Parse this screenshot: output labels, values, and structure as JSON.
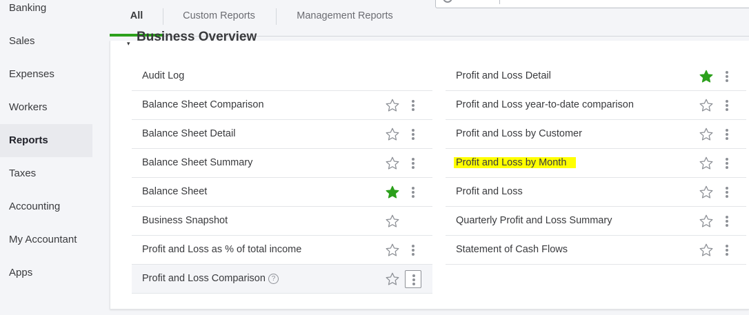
{
  "sidebar": {
    "items": [
      {
        "label": "Banking"
      },
      {
        "label": "Sales"
      },
      {
        "label": "Expenses"
      },
      {
        "label": "Workers"
      },
      {
        "label": "Reports"
      },
      {
        "label": "Taxes"
      },
      {
        "label": "Accounting"
      },
      {
        "label": "My Accountant"
      },
      {
        "label": "Apps"
      }
    ],
    "active": "Reports"
  },
  "tabs": [
    {
      "label": "All",
      "active": true
    },
    {
      "label": "Custom Reports",
      "active": false
    },
    {
      "label": "Management Reports",
      "active": false
    }
  ],
  "section": {
    "title": "Business Overview"
  },
  "left_reports": [
    {
      "label": "Audit Log",
      "favorite": null
    },
    {
      "label": "Balance Sheet Comparison",
      "favorite": false
    },
    {
      "label": "Balance Sheet Detail",
      "favorite": false
    },
    {
      "label": "Balance Sheet Summary",
      "favorite": false
    },
    {
      "label": "Balance Sheet",
      "favorite": true
    },
    {
      "label": "Business Snapshot",
      "favorite": false
    },
    {
      "label": "Profit and Loss as % of total income",
      "favorite": false
    },
    {
      "label": "Profit and Loss Comparison",
      "favorite": false,
      "help": "?"
    }
  ],
  "right_reports": [
    {
      "label": "Profit and Loss Detail",
      "favorite": true
    },
    {
      "label": "Profit and Loss year-to-date comparison",
      "favorite": false
    },
    {
      "label": "Profit and Loss by Customer",
      "favorite": false
    },
    {
      "label": "Profit and Loss by Month",
      "favorite": false,
      "highlighted": true
    },
    {
      "label": "Profit and Loss",
      "favorite": false
    },
    {
      "label": "Quarterly Profit and Loss Summary",
      "favorite": false
    },
    {
      "label": "Statement of Cash Flows",
      "favorite": false
    }
  ],
  "colors": {
    "accent": "#2ca01c",
    "highlight": "#ffff00",
    "star_empty": "#8d9096"
  }
}
